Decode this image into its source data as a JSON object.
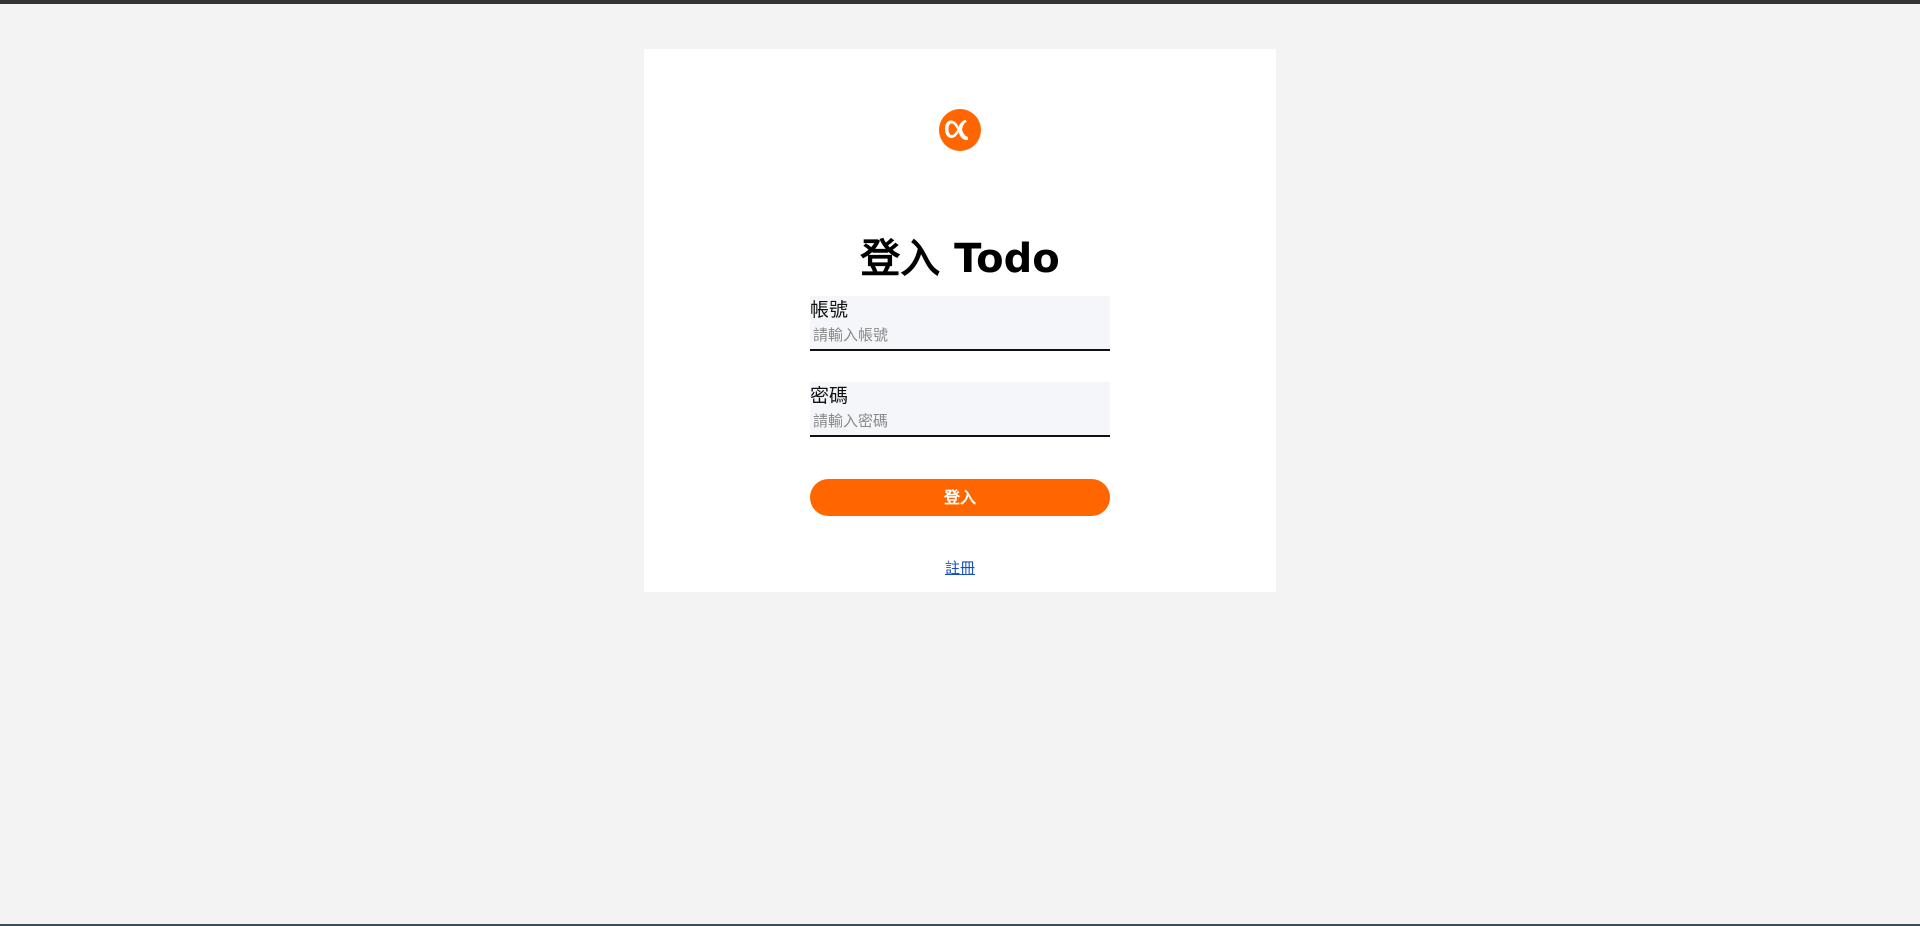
{
  "page": {
    "title": "登入 Todo"
  },
  "brand": {
    "logo_icon": "alpha-logo-icon",
    "accent_color": "#ff6600"
  },
  "form": {
    "username": {
      "label": "帳號",
      "placeholder": "請輸入帳號",
      "value": ""
    },
    "password": {
      "label": "密碼",
      "placeholder": "請輸入密碼",
      "value": ""
    },
    "submit_label": "登入",
    "register_link": "註冊"
  }
}
